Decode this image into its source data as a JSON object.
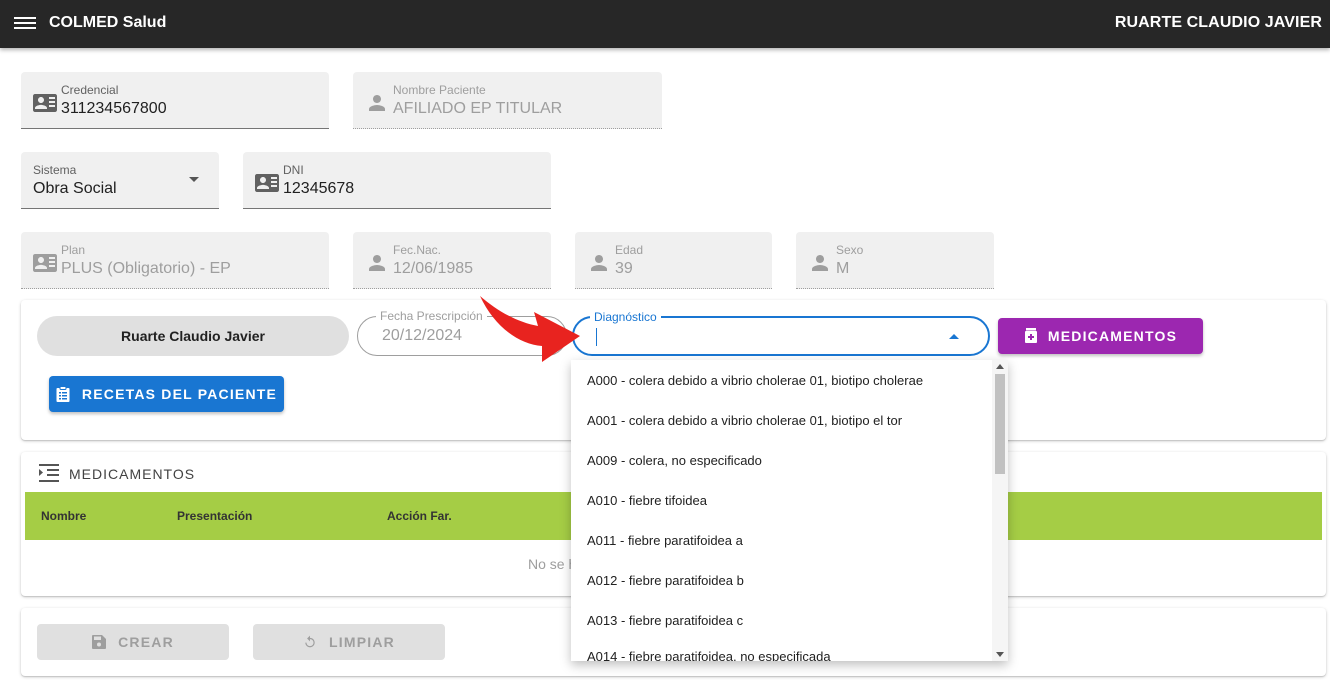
{
  "app": {
    "title": "COLMED Salud",
    "user": "RUARTE CLAUDIO JAVIER"
  },
  "fields": {
    "credencial": {
      "label": "Credencial",
      "value": "311234567800"
    },
    "nombre": {
      "label": "Nombre Paciente",
      "value": "AFILIADO EP TITULAR"
    },
    "sistema": {
      "label": "Sistema",
      "value": "Obra Social"
    },
    "dni": {
      "label": "DNI",
      "value": "12345678"
    },
    "plan": {
      "label": "Plan",
      "value": "PLUS (Obligatorio) - EP"
    },
    "fecnac": {
      "label": "Fec.Nac.",
      "value": "12/06/1985"
    },
    "edad": {
      "label": "Edad",
      "value": "39"
    },
    "sexo": {
      "label": "Sexo",
      "value": "M"
    }
  },
  "prescription": {
    "doctor_chip": "Ruarte Claudio Javier",
    "fecha_label": "Fecha Prescripción",
    "fecha_value": "20/12/2024",
    "diagnostico_label": "Diagnóstico",
    "diagnostico_value": "",
    "medicamentos_button": "MEDICAMENTOS",
    "recetas_button": "RECETAS DEL PACIENTE"
  },
  "diagnostic_options": [
    "A000 - colera debido a vibrio cholerae 01, biotipo cholerae",
    "A001 - colera debido a vibrio cholerae 01, biotipo el tor",
    "A009 - colera, no especificado",
    "A010 - fiebre tifoidea",
    "A011 - fiebre paratifoidea a",
    "A012 - fiebre paratifoidea b",
    "A013 - fiebre paratifoidea c",
    "A014 - fiebre paratifoidea, no especificada"
  ],
  "medicamentos": {
    "title": "MEDICAMENTOS",
    "columns": [
      "Nombre",
      "Presentación",
      "Acción Far."
    ],
    "empty_text": "No se h"
  },
  "actions": {
    "crear": "CREAR",
    "limpiar": "LIMPIAR"
  },
  "colors": {
    "topbar": "#272727",
    "purple": "#9c27b0",
    "blue": "#1976d2",
    "table_header": "#a5cd45",
    "arrow": "#e8231f"
  }
}
